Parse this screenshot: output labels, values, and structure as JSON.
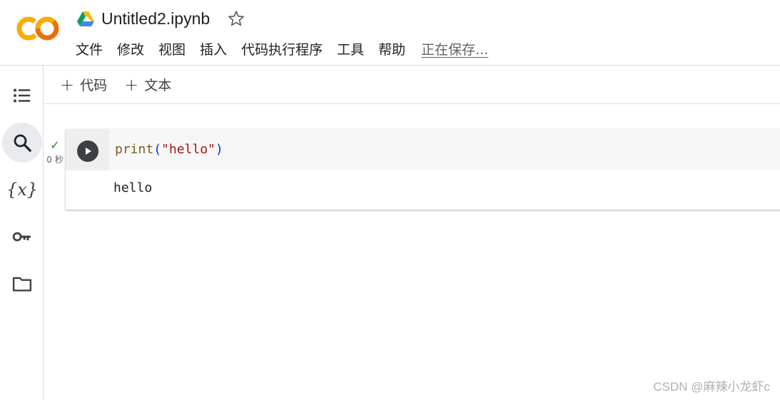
{
  "app": {
    "logo_text": "CO",
    "colors": {
      "logo_orange": "#f9ab00",
      "logo_dark_orange": "#e8710a"
    }
  },
  "header": {
    "title": "Untitled2.ipynb",
    "drive_icon": "google-drive-icon",
    "star_icon": "star-outline-icon",
    "menu": [
      {
        "label": "文件"
      },
      {
        "label": "修改"
      },
      {
        "label": "视图"
      },
      {
        "label": "插入"
      },
      {
        "label": "代码执行程序"
      },
      {
        "label": "工具"
      },
      {
        "label": "帮助"
      }
    ],
    "save_status": "正在保存..."
  },
  "sidebar": {
    "items": [
      {
        "icon": "table-of-contents-icon",
        "active": false
      },
      {
        "icon": "search-icon",
        "active": true
      },
      {
        "icon": "variables-icon",
        "glyph": "{𝑥}",
        "active": false
      },
      {
        "icon": "key-icon",
        "active": false
      },
      {
        "icon": "folder-icon",
        "active": false
      }
    ]
  },
  "toolbar": {
    "add_code_label": "代码",
    "add_text_label": "文本",
    "plus": "+"
  },
  "cell": {
    "status_check": "✓",
    "exec_time": "0 秒",
    "code": {
      "fn": "print",
      "open": "(",
      "str": "\"hello\"",
      "close": ")"
    },
    "output": "hello"
  },
  "watermark": "CSDN @麻辣小龙虾c"
}
